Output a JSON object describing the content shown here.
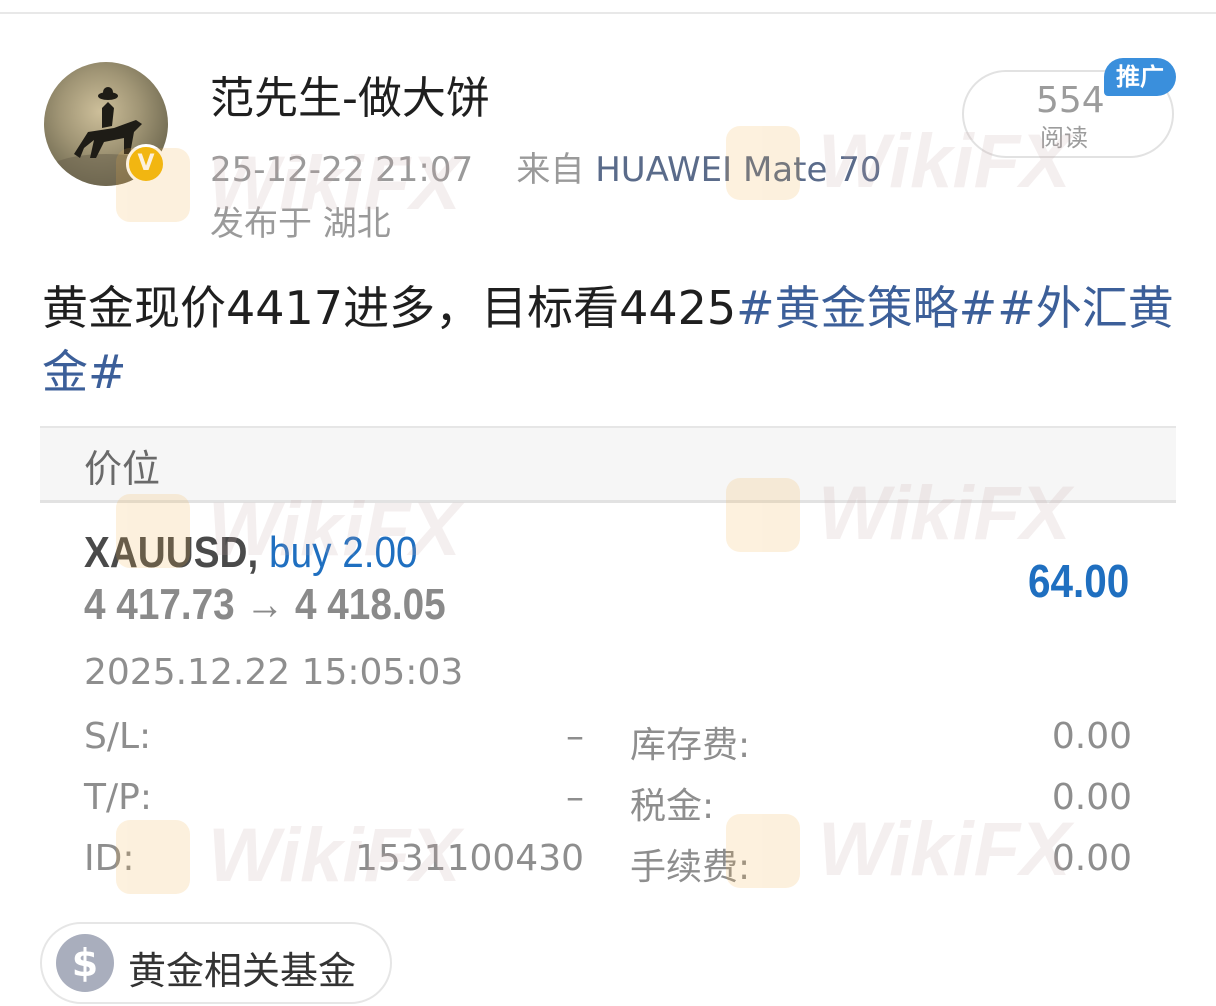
{
  "post": {
    "author": "范先生-做大饼",
    "timestamp": "25-12-22 21:07",
    "from_prefix": "来自",
    "device": "HUAWEI Mate 70",
    "location": "发布于 湖北",
    "reads_count": "554",
    "reads_label": "阅读",
    "promo_badge": "推广",
    "verified_badge": "V",
    "text_plain": "黄金现价4417进多，目标看4425",
    "text_tag1": "#黄金策略#",
    "text_tag2": "#外汇黄金#"
  },
  "trade_card": {
    "header": "价位",
    "symbol": "XAUUSD,",
    "side": "buy 2.00",
    "price_open": "4 417.73",
    "arrow": "→",
    "price_close": "4 418.05",
    "profit": "64.00",
    "datetime": "2025.12.22 15:05:03",
    "rows": [
      {
        "label": "S/L:",
        "value": "–",
        "label2": "库存费:",
        "value2": "0.00"
      },
      {
        "label": "T/P:",
        "value": "–",
        "label2": "税金:",
        "value2": "0.00"
      },
      {
        "label": "ID:",
        "value": "1531100430",
        "label2": "手续费:",
        "value2": "0.00"
      }
    ]
  },
  "related": {
    "icon": "$",
    "label": "黄金相关基金"
  },
  "watermark": "WikiFX",
  "colors": {
    "accent_blue": "#1f6fc0",
    "tag_blue": "#3c5f99",
    "promo_blue": "#3a8fdc",
    "verified_gold": "#f2b705"
  },
  "icons": [
    "verified-icon",
    "dollar-icon",
    "avatar-rider-image"
  ]
}
